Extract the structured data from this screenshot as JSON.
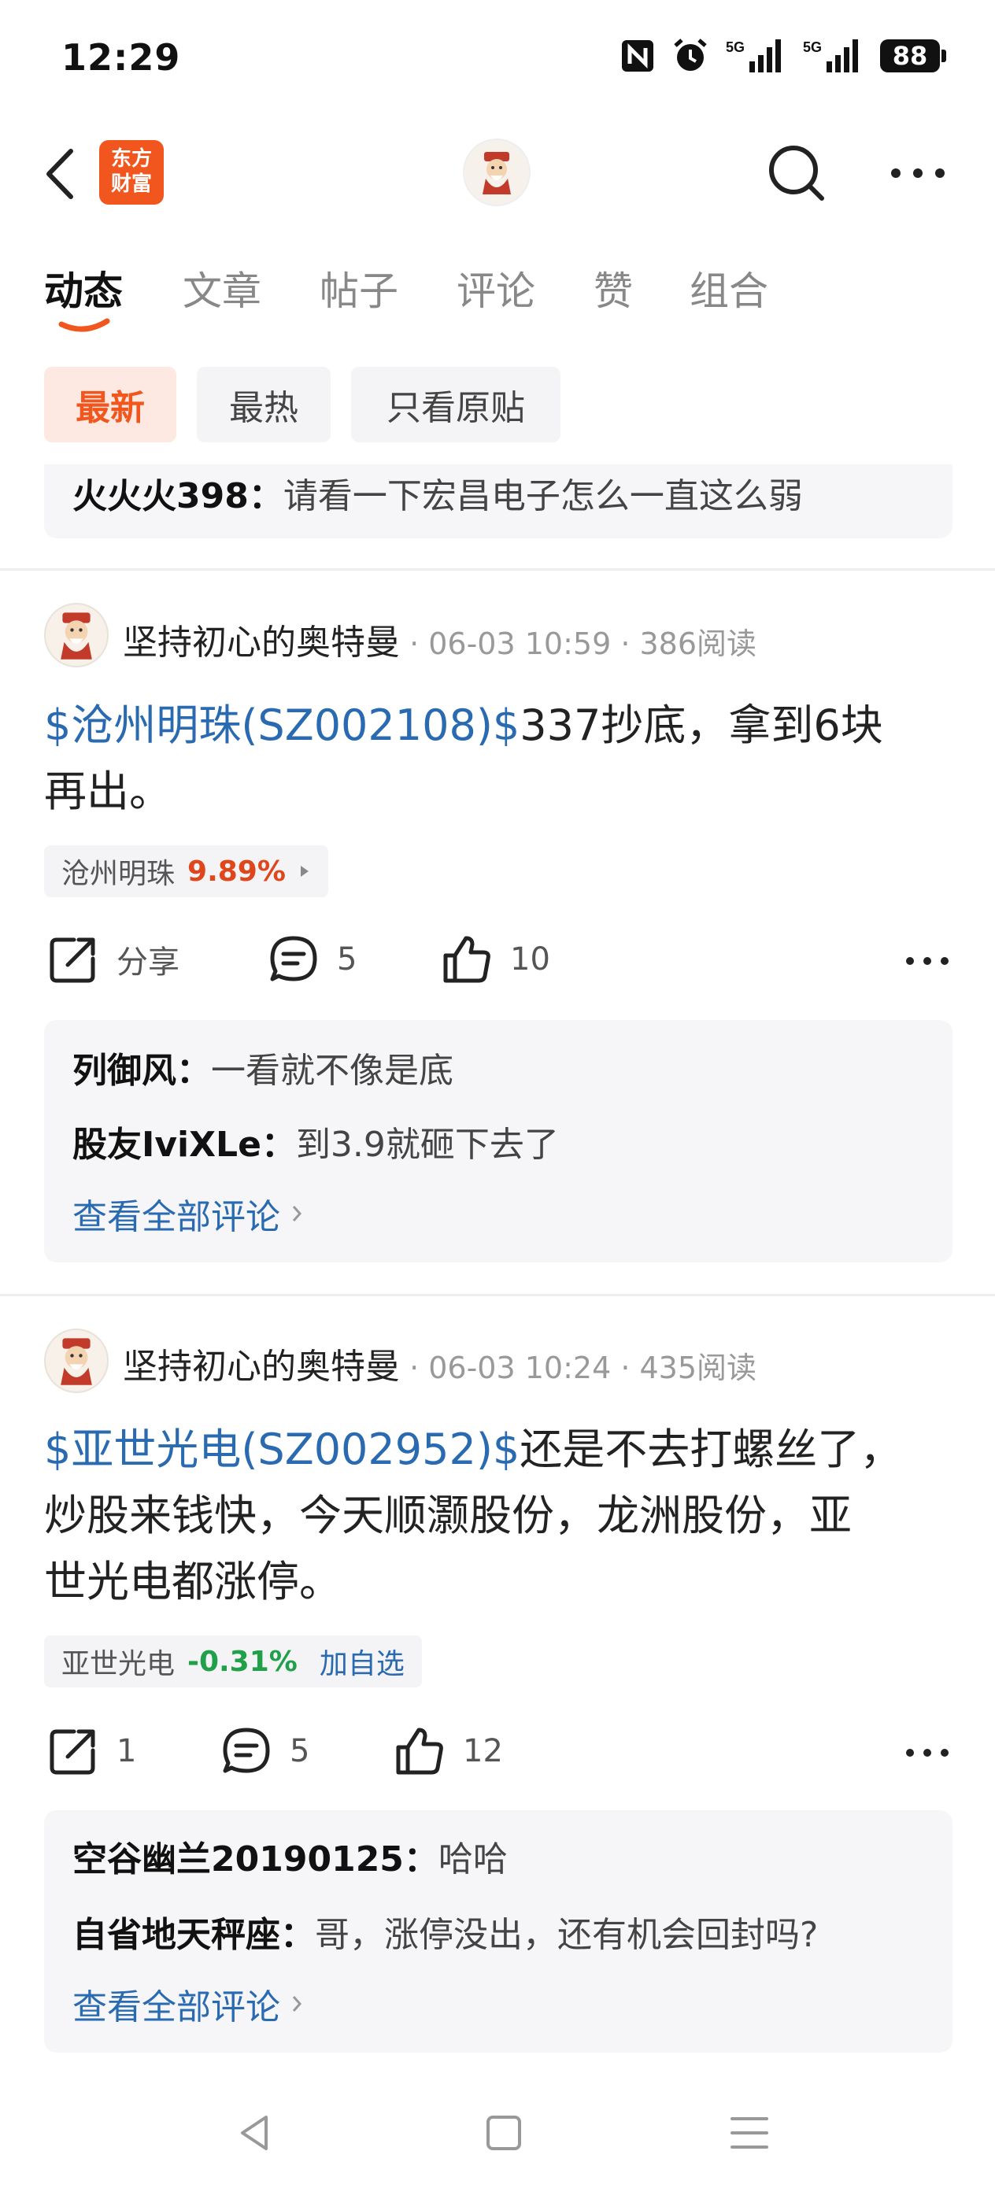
{
  "status_bar": {
    "time": "12:29",
    "icons": [
      "nfc-icon",
      "alarm-icon",
      "signal-5g-icon",
      "signal-5g-icon"
    ],
    "signal_1": "5G",
    "signal_2": "5G",
    "battery": "88"
  },
  "header": {
    "logo_line1": "东方",
    "logo_line2": "财富"
  },
  "tabs": [
    {
      "label": "动态",
      "active": true
    },
    {
      "label": "文章",
      "active": false
    },
    {
      "label": "帖子",
      "active": false
    },
    {
      "label": "评论",
      "active": false
    },
    {
      "label": "赞",
      "active": false
    },
    {
      "label": "组合",
      "active": false
    }
  ],
  "filters": [
    {
      "label": "最新",
      "active": true
    },
    {
      "label": "最热",
      "active": false
    },
    {
      "label": "只看原贴",
      "active": false
    }
  ],
  "prev_comment": {
    "author": "火火火398：",
    "text": "请看一下宏昌电子怎么一直这么弱"
  },
  "posts": [
    {
      "author": "坚持初心的奥特曼",
      "meta": " · 06-03 10:59 · 386阅读",
      "stock_link": "$沧州明珠(SZ002108)$",
      "text_line1": "337抄底，拿到6块",
      "text_line2": "再出。",
      "tag_name": "沧州明珠",
      "tag_pct": "9.89%",
      "share_label": "分享",
      "comments": "5",
      "likes": "10",
      "comment_preview": [
        {
          "author": "列御风：",
          "text": "一看就不像是底"
        },
        {
          "author": "股友IviXLe：",
          "text": "到3.9就砸下去了"
        }
      ],
      "view_all": "查看全部评论"
    },
    {
      "author": "坚持初心的奥特曼",
      "meta": " · 06-03 10:24 · 435阅读",
      "stock_link": "$亚世光电(SZ002952)$",
      "text_line1": "还是不去打螺丝了，",
      "text_line2": "炒股来钱快，今天顺灏股份，龙洲股份，亚",
      "text_line3": "世光电都涨停。",
      "tag_name": "亚世光电",
      "tag_pct": "-0.31%",
      "tag_add": "加自选",
      "share_count": "1",
      "comments": "5",
      "likes": "12",
      "comment_preview": [
        {
          "author": "空谷幽兰20190125：",
          "text": "哈哈"
        },
        {
          "author": "自省地天秤座：",
          "text": "哥，涨停没出，还有机会回封吗?"
        }
      ],
      "view_all": "查看全部评论"
    }
  ],
  "colors": {
    "accent": "#f0561d",
    "link": "#2a6ab0",
    "up": "#e0461c",
    "down": "#21a04a"
  }
}
